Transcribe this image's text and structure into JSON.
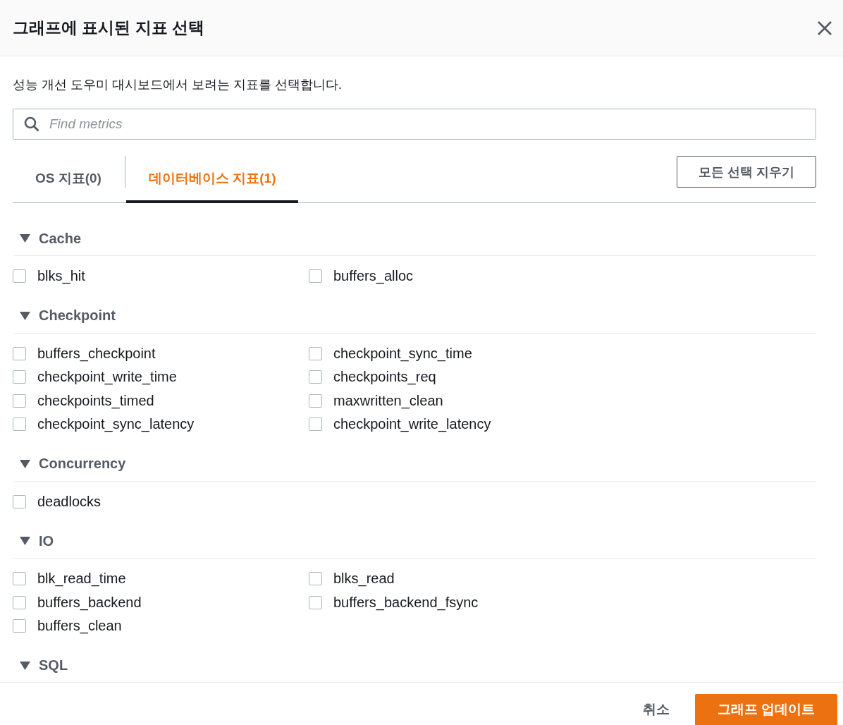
{
  "dialog": {
    "title": "그래프에 표시된 지표 선택"
  },
  "description": "성능 개선 도우미 대시보드에서 보려는 지표를 선택합니다.",
  "search": {
    "placeholder": "Find metrics"
  },
  "tabs": [
    {
      "label": "OS 지표(0)",
      "selected": false
    },
    {
      "label": "데이터베이스 지표(1)",
      "selected": true
    }
  ],
  "clear_button": "모든 선택 지우기",
  "groups": [
    {
      "name": "Cache",
      "expanded": true,
      "metrics": [
        {
          "label": "blks_hit",
          "checked": false
        },
        {
          "label": "buffers_alloc",
          "checked": false
        }
      ]
    },
    {
      "name": "Checkpoint",
      "expanded": true,
      "metrics": [
        {
          "label": "buffers_checkpoint",
          "checked": false
        },
        {
          "label": "checkpoint_sync_time",
          "checked": false
        },
        {
          "label": "checkpoint_write_time",
          "checked": false
        },
        {
          "label": "checkpoints_req",
          "checked": false
        },
        {
          "label": "checkpoints_timed",
          "checked": false
        },
        {
          "label": "maxwritten_clean",
          "checked": false
        },
        {
          "label": "checkpoint_sync_latency",
          "checked": false
        },
        {
          "label": "checkpoint_write_latency",
          "checked": false
        }
      ]
    },
    {
      "name": "Concurrency",
      "expanded": true,
      "metrics": [
        {
          "label": "deadlocks",
          "checked": false
        }
      ]
    },
    {
      "name": "IO",
      "expanded": true,
      "metrics": [
        {
          "label": "blk_read_time",
          "checked": false
        },
        {
          "label": "blks_read",
          "checked": false
        },
        {
          "label": "buffers_backend",
          "checked": false
        },
        {
          "label": "buffers_backend_fsync",
          "checked": false
        },
        {
          "label": "buffers_clean",
          "checked": false
        }
      ]
    },
    {
      "name": "SQL",
      "expanded": true
    }
  ],
  "footer": {
    "cancel": "취소",
    "primary": "그래프 업데이트"
  }
}
